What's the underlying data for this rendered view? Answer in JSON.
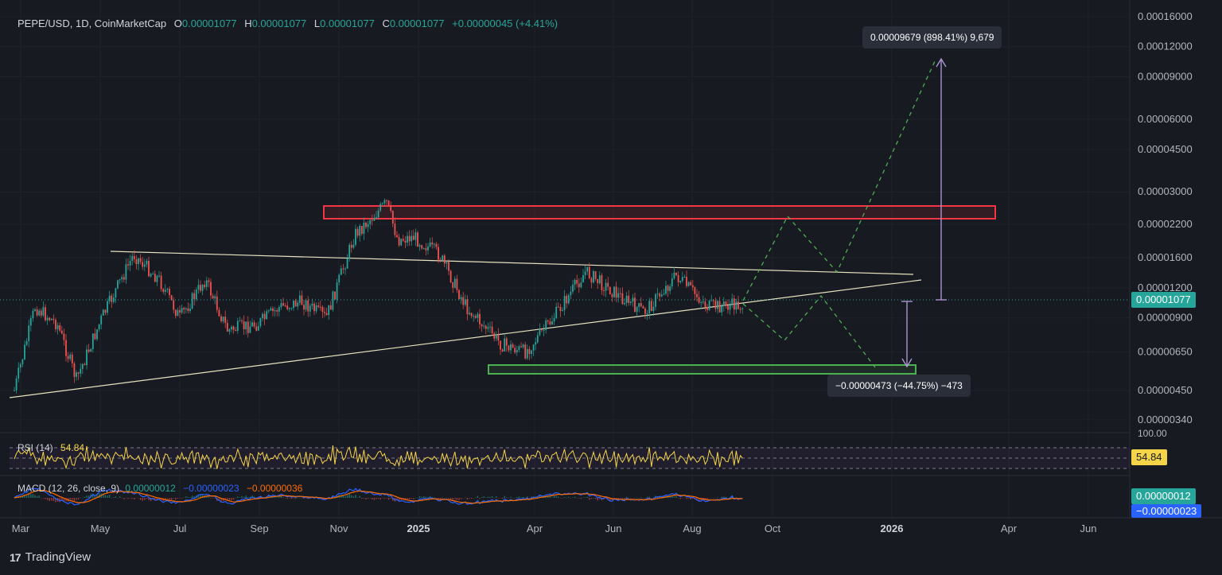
{
  "header": {
    "symbol": "PEPE/USD, 1D, CoinMarketCap",
    "o_label": "O",
    "o_value": "0.00001077",
    "h_label": "H",
    "h_value": "0.00001077",
    "l_label": "L",
    "l_value": "0.00001077",
    "c_label": "C",
    "c_value": "0.00001077",
    "change": "+0.00000045 (+4.41%)"
  },
  "rsi": {
    "label": "RSI (14)",
    "value": "54.84",
    "axis_top": "100.00",
    "tag": "54.84"
  },
  "macd": {
    "label": "MACD (12, 26, close, 9)",
    "v1": "0.00000012",
    "v2": "−0.00000023",
    "v3": "−0.00000036",
    "tag1": "0.00000012",
    "tag2": "−0.00000023"
  },
  "price_tag": "0.00001077",
  "measure_up": "0.00009679 (898.41%) 9,679",
  "measure_down": "−0.00000473 (−44.75%) −473",
  "brand": {
    "name": "TradingView",
    "logo": "17"
  },
  "colors": {
    "bg": "#181a21",
    "up": "#26a69a",
    "down": "#ef5350",
    "resistance": "#f23645",
    "support": "#4caf50",
    "trendline": "#e8e2c0",
    "rsi": "#f5d547",
    "macd_line": "#2962ff",
    "signal_line": "#ff6d00"
  },
  "chart_data": {
    "type": "candlestick",
    "scale": "log",
    "y_ticks": [
      "0.00016000",
      "0.00012000",
      "0.00009000",
      "0.00006000",
      "0.00004500",
      "0.00003000",
      "0.00002200",
      "0.00001600",
      "0.00001200",
      "0.00000900",
      "0.00000650",
      "0.00000450",
      "0.00000340"
    ],
    "x_ticks": [
      "Mar",
      "May",
      "Jul",
      "Sep",
      "Nov",
      "2025",
      "Apr",
      "Jun",
      "Aug",
      "Oct",
      "2026",
      "Apr",
      "Jun"
    ],
    "close_path": [
      [
        "Mar",
        4.5e-06
      ],
      [
        "Mar",
        1e-05
      ],
      [
        "Apr",
        8.5e-06
      ],
      [
        "Apr",
        5e-06
      ],
      [
        "May",
        9e-06
      ],
      [
        "May",
        1.65e-05
      ],
      [
        "Jun",
        1.3e-05
      ],
      [
        "Jul",
        9e-06
      ],
      [
        "Jul",
        1.3e-05
      ],
      [
        "Aug",
        8e-06
      ],
      [
        "Sep",
        8.5e-06
      ],
      [
        "Sep",
        1e-05
      ],
      [
        "Oct",
        1.05e-05
      ],
      [
        "Oct",
        9e-06
      ],
      [
        "Nov",
        2e-05
      ],
      [
        "Dec",
        2.7e-05
      ],
      [
        "Dec",
        1.9e-05
      ],
      [
        "2025",
        1.95e-05
      ],
      [
        "2025",
        1.65e-05
      ],
      [
        "Feb",
        1e-05
      ],
      [
        "Mar",
        7e-06
      ],
      [
        "Apr",
        6.5e-06
      ],
      [
        "Apr",
        8.5e-06
      ],
      [
        "May",
        1.4e-05
      ],
      [
        "Jun",
        1.1e-05
      ],
      [
        "Jul",
        9.5e-06
      ],
      [
        "Jul",
        1.35e-05
      ],
      [
        "Aug",
        1e-05
      ],
      [
        "Aug",
        1.02e-05
      ]
    ],
    "zones": [
      {
        "name": "resistance",
        "low": 2.35e-05,
        "high": 2.65e-05
      },
      {
        "name": "support",
        "low": 5.8e-06,
        "high": 6.2e-06
      }
    ],
    "projections": [
      "bullish breakout to 0.00009679 (898.41%)",
      "bearish breakdown to −0.00000473 (−44.75%)"
    ],
    "grid": true
  }
}
